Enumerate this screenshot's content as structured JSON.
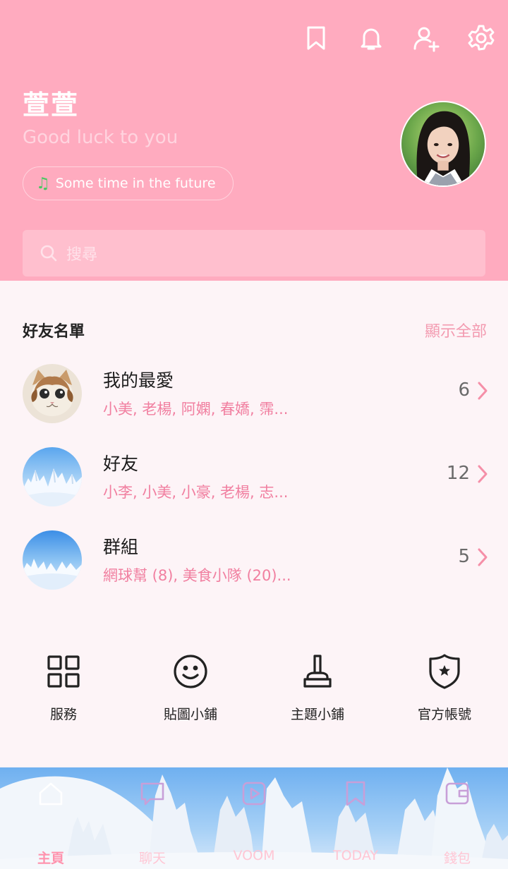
{
  "header": {
    "profile_name": "萱萱",
    "status_message": "Good luck to you",
    "music": "Some time in the future",
    "search_placeholder": "搜尋"
  },
  "friends": {
    "title": "好友名單",
    "show_all": "顯示全部",
    "rows": [
      {
        "title": "我的最愛",
        "sub": "小美, 老楊, 阿嫻, 春嬌, 霈...",
        "count": "6"
      },
      {
        "title": "好友",
        "sub": "小李, 小美, 小豪, 老楊, 志...",
        "count": "12"
      },
      {
        "title": "群組",
        "sub": "網球幫 (8), 美食小隊 (20)...",
        "count": "5"
      }
    ]
  },
  "services": [
    {
      "label": "服務",
      "icon": "grid-icon"
    },
    {
      "label": "貼圖小鋪",
      "icon": "smiley-icon"
    },
    {
      "label": "主題小鋪",
      "icon": "brush-icon"
    },
    {
      "label": "官方帳號",
      "icon": "shield-star-icon"
    }
  ],
  "nav": [
    {
      "label": "主頁",
      "icon": "home-icon",
      "active": true
    },
    {
      "label": "聊天",
      "icon": "chat-icon",
      "active": false
    },
    {
      "label": "VOOM",
      "icon": "play-icon",
      "active": false
    },
    {
      "label": "TODAY",
      "icon": "news-icon",
      "active": false
    },
    {
      "label": "錢包",
      "icon": "wallet-icon",
      "active": false
    }
  ],
  "colors": {
    "header_bg": "#ffabbf",
    "accent_pink": "#f17fa0",
    "music_note": "#4cc764",
    "page_bg": "#fdf4f7"
  }
}
